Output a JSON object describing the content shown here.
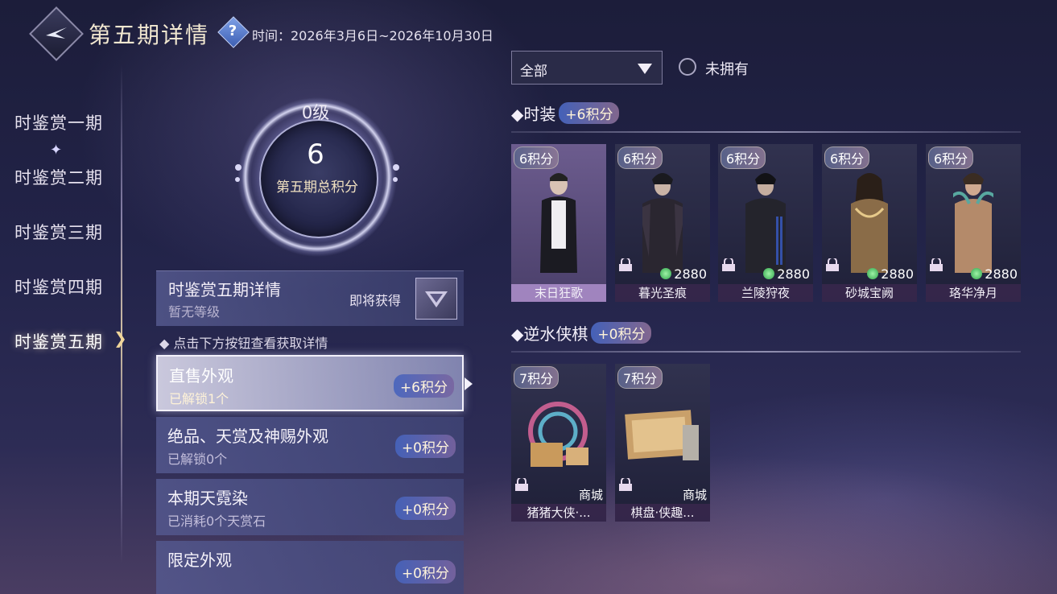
{
  "header": {
    "title": "第五期详情",
    "help_icon": "question-icon",
    "time_text": "时间：2026年3月6日~2026年10月30日"
  },
  "nav": {
    "items": [
      {
        "label": "时鉴赏一期",
        "active": false
      },
      {
        "label": "时鉴赏二期",
        "active": false
      },
      {
        "label": "时鉴赏三期",
        "active": false
      },
      {
        "label": "时鉴赏四期",
        "active": false
      },
      {
        "label": "时鉴赏五期",
        "active": true
      }
    ]
  },
  "score": {
    "level": "0级",
    "value": "6",
    "label": "第五期总积分"
  },
  "detail": {
    "title": "时鉴赏五期详情",
    "subtitle": "暂无等级",
    "soon_label": "即将获得",
    "hint": "点击下方按钮查看获取详情"
  },
  "sources": [
    {
      "title": "直售外观",
      "sub": "已解锁1个",
      "badge": "+6积分",
      "active": true
    },
    {
      "title": "绝品、天赏及神赐外观",
      "sub": "已解锁0个",
      "badge": "+0积分",
      "active": false
    },
    {
      "title": "本期天霓染",
      "sub": "已消耗0个天赏石",
      "badge": "+0积分",
      "active": false
    },
    {
      "title": "限定外观",
      "sub": "",
      "badge": "+0积分",
      "active": false
    }
  ],
  "filter": {
    "selected": "全部",
    "radio_label": "未拥有"
  },
  "sections": [
    {
      "title": "时装",
      "badge": "+6积分",
      "cards": [
        {
          "points": "6积分",
          "name": "末日狂歌",
          "price": "",
          "shop": "",
          "owned": true
        },
        {
          "points": "6积分",
          "name": "暮光圣痕",
          "price": "2880",
          "shop": "",
          "owned": false
        },
        {
          "points": "6积分",
          "name": "兰陵狩夜",
          "price": "2880",
          "shop": "",
          "owned": false
        },
        {
          "points": "6积分",
          "name": "砂城宝阙",
          "price": "2880",
          "shop": "",
          "owned": false
        },
        {
          "points": "6积分",
          "name": "珞华净月",
          "price": "2880",
          "shop": "",
          "owned": false
        }
      ]
    },
    {
      "title": "逆水侠棋",
      "badge": "+0积分",
      "cards": [
        {
          "points": "7积分",
          "name": "猪猪大侠·...",
          "price": "",
          "shop": "商城",
          "owned": false
        },
        {
          "points": "7积分",
          "name": "棋盘·侠趣...",
          "price": "",
          "shop": "商城",
          "owned": false
        }
      ]
    }
  ],
  "colors": {
    "background": "#23244a",
    "accent_gold": "#f0d59a",
    "badge_blue": "#4664be"
  }
}
